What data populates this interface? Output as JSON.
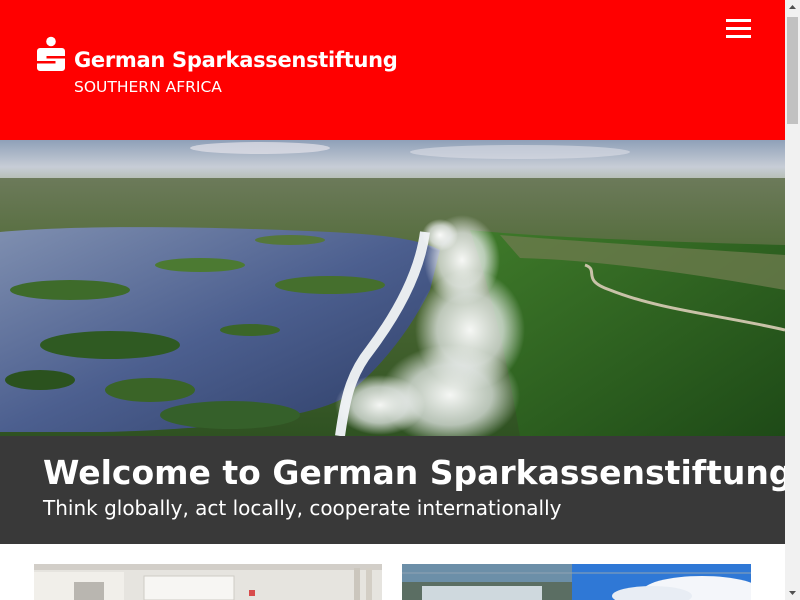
{
  "header": {
    "brand_name": "German Sparkassenstiftung",
    "brand_subtitle": "SOUTHERN AFRICA",
    "background_color": "#ff0000",
    "menu_icon": "hamburger-menu-icon"
  },
  "hero": {
    "image": "aerial view of a large waterfall with mist, river with islands and forest"
  },
  "welcome": {
    "title": "Welcome to German Sparkassenstiftung",
    "subtitle": "Think globally, act locally, cooperate internationally",
    "background_color": "#393939"
  },
  "cards": [
    {
      "image": "conference room photo"
    },
    {
      "image": "waterfall and sky photo"
    }
  ]
}
